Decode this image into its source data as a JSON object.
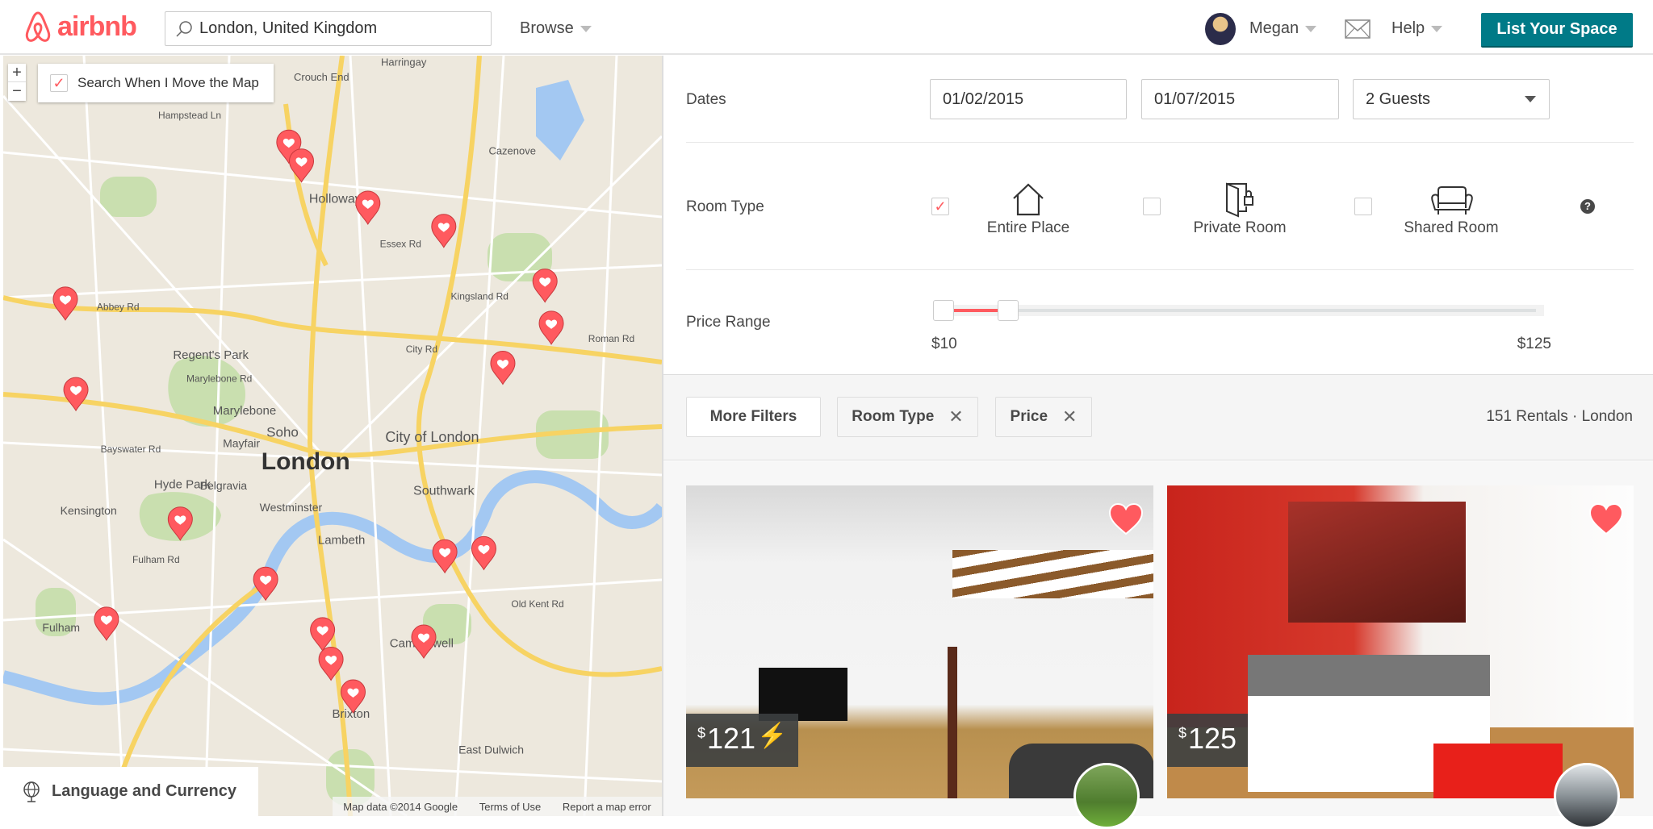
{
  "header": {
    "logo_text": "airbnb",
    "search_value": "London, United Kingdom",
    "browse": "Browse",
    "user": "Megan",
    "help": "Help",
    "list_space": "List Your Space",
    "brand_color": "#ff5a5f",
    "accent_color": "#007a87"
  },
  "map": {
    "zoom_in": "+",
    "zoom_out": "−",
    "search_when_move": "Search When I Move the Map",
    "search_when_move_checked": true,
    "place_labels": [
      "London",
      "Regent's Park",
      "Hyde Park",
      "Soho",
      "City of London",
      "Southwark",
      "Westminster",
      "Lambeth",
      "Brixton",
      "Kensington",
      "Belgravia",
      "Marylebone",
      "Mayfair",
      "Holloway",
      "Crouch End",
      "Harringay",
      "Cazenove",
      "Fulham",
      "East Dulwich",
      "Camberwell",
      "Abbey Rd",
      "Marylebone Rd",
      "City Rd",
      "Old Kent Rd",
      "Essex Rd",
      "Kingsland Rd",
      "Roman Rd",
      "Bayswater Rd",
      "Fulham Rd",
      "Hampstead Ln"
    ],
    "language_currency": "Language and Currency",
    "attribution": "Map data ©2014 Google",
    "terms": "Terms of Use",
    "report": "Report a map error"
  },
  "filters": {
    "dates_label": "Dates",
    "checkin": "01/02/2015",
    "checkout": "01/07/2015",
    "guests": "2 Guests",
    "room_type_label": "Room Type",
    "room_types": [
      {
        "label": "Entire Place",
        "checked": true,
        "icon": "house-icon"
      },
      {
        "label": "Private Room",
        "checked": false,
        "icon": "door-lock-icon"
      },
      {
        "label": "Shared Room",
        "checked": false,
        "icon": "couch-icon"
      }
    ],
    "help_icon": "?",
    "price_range_label": "Price Range",
    "price_min": "$10",
    "price_max": "$125",
    "slider_low_fraction": 0.0,
    "slider_high_fraction": 0.11
  },
  "toolbar": {
    "more_filters": "More Filters",
    "chips": [
      "Room Type",
      "Price"
    ],
    "results": "151 Rentals · London"
  },
  "listings": [
    {
      "currency": "$",
      "price": "121",
      "instant_book": true,
      "favorited": true
    },
    {
      "currency": "$",
      "price": "125",
      "instant_book": false,
      "favorited": true
    }
  ]
}
